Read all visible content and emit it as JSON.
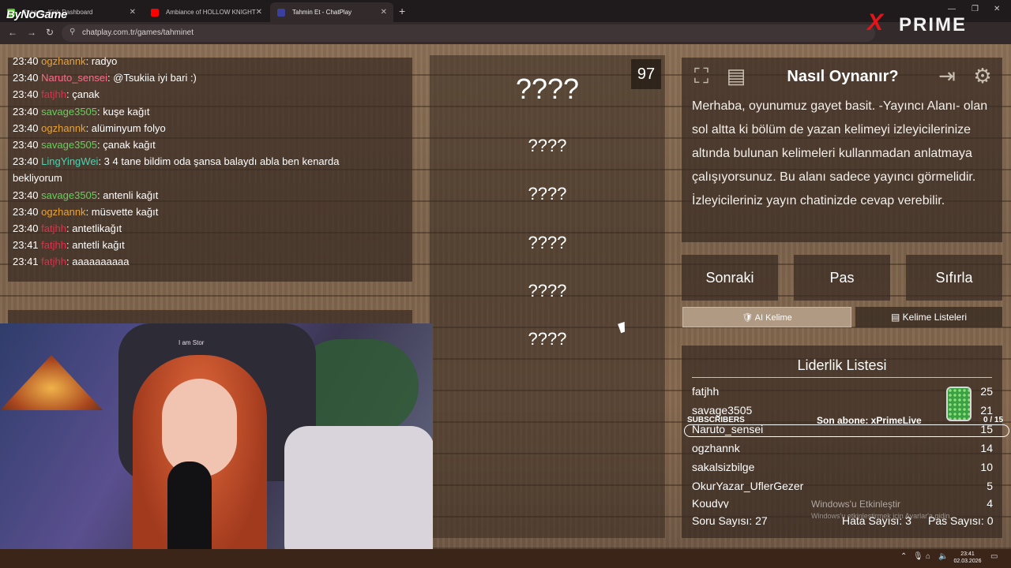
{
  "browser": {
    "tabs": [
      {
        "label": "Stream - Kick Dashboard",
        "active": false
      },
      {
        "label": "Ambiance of HOLLOW KNIGHT",
        "active": false
      },
      {
        "label": "Tahmin Et - ChatPlay",
        "active": true
      }
    ],
    "url": "chatplay.com.tr/games/tahminet"
  },
  "overlays": {
    "left_brand": "ByNoGame",
    "right_brand_x": "X",
    "right_brand_rest": "PRIME"
  },
  "chat": {
    "messages": [
      {
        "time": "23:40",
        "user": "ogzhannk",
        "text": ": radyo",
        "color": "orange"
      },
      {
        "time": "23:40",
        "user": "Naruto_sensei",
        "text": ": @Tsukiia iyi bari :)",
        "color": "pink"
      },
      {
        "time": "23:40",
        "user": "fatjhh",
        "text": ": çanak",
        "color": "red"
      },
      {
        "time": "23:40",
        "user": "savage3505",
        "text": ": kuşe kağıt",
        "color": "green"
      },
      {
        "time": "23:40",
        "user": "ogzhannk",
        "text": ": alüminyum folyo",
        "color": "orange"
      },
      {
        "time": "23:40",
        "user": "savage3505",
        "text": ": çanak kağıt",
        "color": "green"
      },
      {
        "time": "23:40",
        "user": "LingYingWei",
        "text": ": 3 4 tane bildim oda şansa balaydı abla ben kenarda",
        "color": "teal"
      },
      {
        "time": "",
        "user": "",
        "text": "bekliyorum",
        "color": "teal"
      },
      {
        "time": "23:40",
        "user": "savage3505",
        "text": ": antenli kağıt",
        "color": "green"
      },
      {
        "time": "23:40",
        "user": "ogzhannk",
        "text": ": müsvette kağıt",
        "color": "orange"
      },
      {
        "time": "23:40",
        "user": "fatjhh",
        "text": ": antetlikağıt",
        "color": "red"
      },
      {
        "time": "23:41",
        "user": "fatjhh",
        "text": ": antetli kağıt",
        "color": "red"
      },
      {
        "time": "23:41",
        "user": "fatjhh",
        "text": ": aaaaaaaaaa",
        "color": "red"
      }
    ]
  },
  "game": {
    "counter": "97",
    "main_word": "????",
    "words": [
      "????",
      "????",
      "????",
      "????",
      "????"
    ]
  },
  "howto": {
    "title": "Nasıl Oynanır?",
    "text": "Merhaba, oyunumuz gayet basit. -Yayıncı Alanı- olan sol altta ki bölüm de yazan kelimeyi izleyicilerinize altında bulunan kelimeleri kullanmadan anlatmaya çalışıyorsunuz. Bu alanı sadece yayıncı görmelidir. İzleyicileriniz yayın chatinizde cevap verebilir."
  },
  "controls": {
    "next": "Sonraki",
    "pass": "Pas",
    "reset": "Sıfırla",
    "ai_word": "AI Kelime",
    "word_lists": "Kelime Listeleri"
  },
  "leaderboard": {
    "title": "Liderlik Listesi",
    "rows": [
      {
        "name": "fatjhh",
        "score": "25"
      },
      {
        "name": "savage3505",
        "score": "21"
      },
      {
        "name": "Naruto_sensei",
        "score": "15"
      },
      {
        "name": "ogzhannk",
        "score": "14"
      },
      {
        "name": "sakalsizbilge",
        "score": "10"
      },
      {
        "name": "OkurYazar_UflerGezer",
        "score": "5"
      },
      {
        "name": "Koudyy",
        "score": "4"
      }
    ],
    "questions": "Soru Sayısı: 27",
    "errors": "Hata Sayısı: 3",
    "passes": "Pas Sayısı: 0"
  },
  "sub_overlay": {
    "label": "SUBSCRIBERS",
    "last": "Son abone: xPrimeLive",
    "count": "0 / 15"
  },
  "watermark": {
    "line1": "Windows'u Etkinleştir",
    "line2": "Windows'u etkinleştirmek için Ayarlar'a gidin."
  },
  "webcam": {
    "chair_text": "I am Stor"
  },
  "taskbar": {
    "time": "23:41",
    "date": "02.03.2026"
  }
}
